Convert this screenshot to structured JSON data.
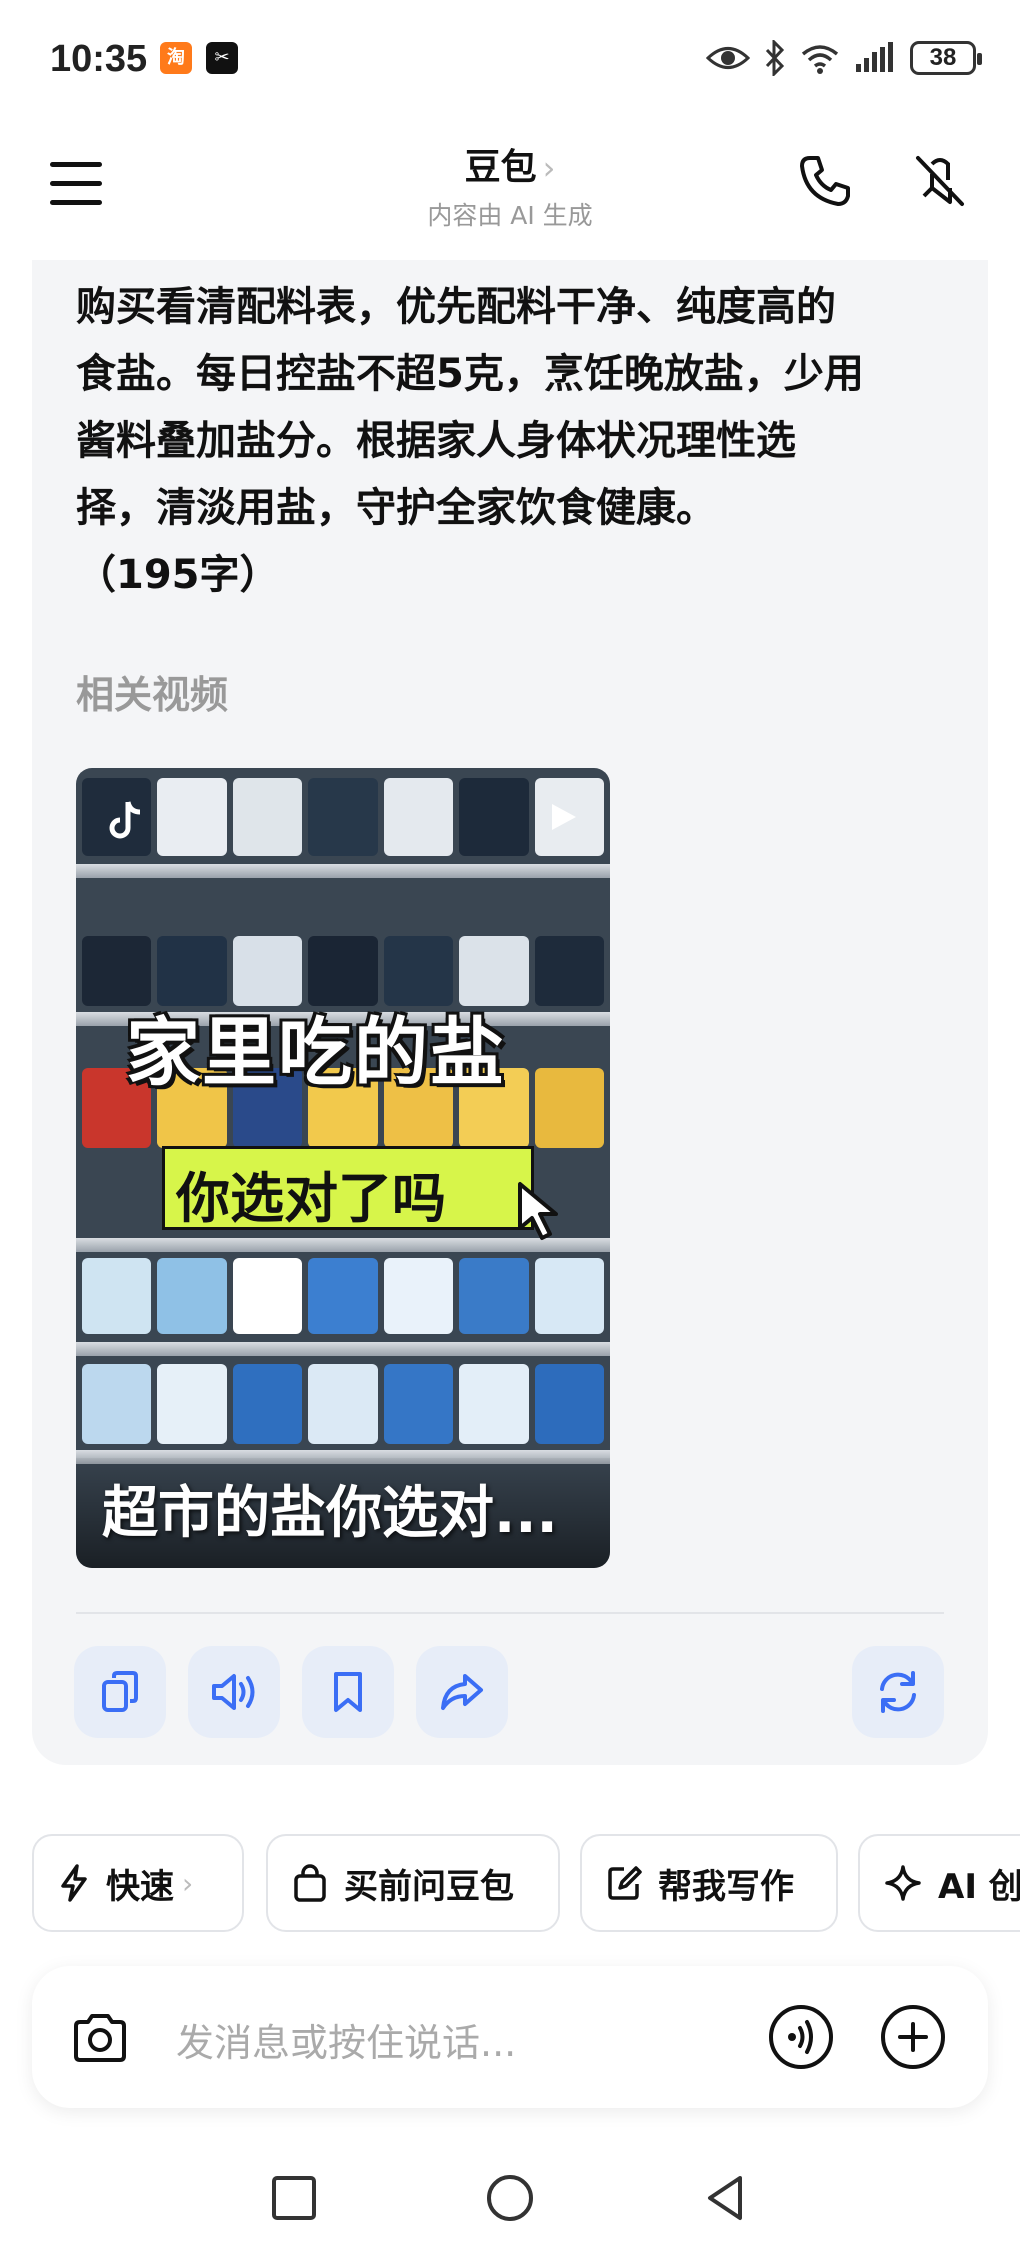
{
  "status_bar": {
    "time": "10:35",
    "app1_icon": "taobao-icon",
    "app2_icon": "capcut-icon",
    "battery": "38"
  },
  "header": {
    "title": "豆包",
    "subtitle": "内容由 AI 生成"
  },
  "answer": {
    "lines": [
      "购买看清配料表，优先配料干净、纯度高的",
      "食盐。每日控盐不超5克，烹饪晚放盐，少用",
      "酱料叠加盐分。根据家人身体状况理性选",
      "择，清淡用盐，守护全家饮食健康。",
      "（195字）"
    ]
  },
  "related": {
    "title": "相关视频",
    "video": {
      "overlay_big": "家里吃的盐",
      "overlay_small": "你选对了吗",
      "caption": "超市的盐你选对..."
    }
  },
  "actions": [
    "copy-icon",
    "speaker-icon",
    "bookmark-icon",
    "share-icon",
    "regenerate-icon"
  ],
  "chips": [
    {
      "label": "快速",
      "icon": "lightning-icon"
    },
    {
      "label": "买前问豆包",
      "icon": "shopping-bag-icon"
    },
    {
      "label": "帮我写作",
      "icon": "edit-icon"
    },
    {
      "label": "AI 创",
      "icon": "sparkle-icon"
    }
  ],
  "input": {
    "placeholder": "发消息或按住说话..."
  },
  "colors": {
    "card_bg": "#f4f5f7",
    "action_bg": "#e7edf8",
    "action_icon": "#3b6ef5",
    "banner": "#d7f54a"
  }
}
